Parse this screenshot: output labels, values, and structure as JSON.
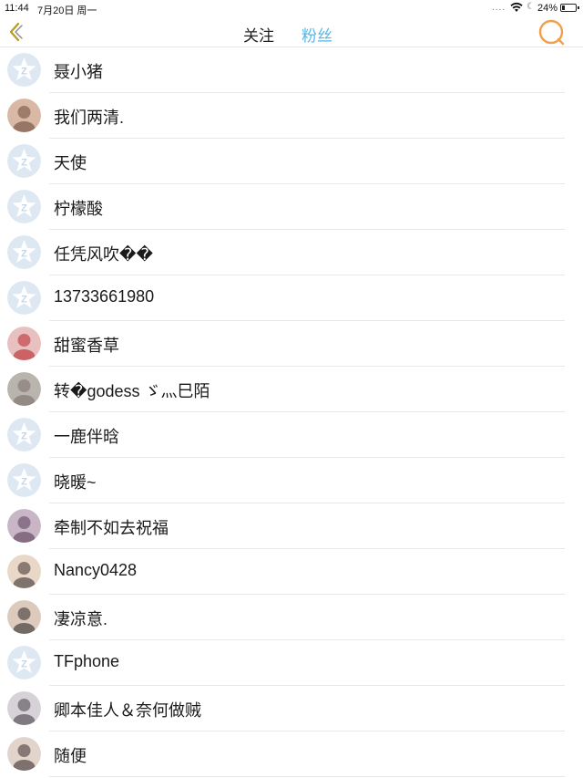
{
  "status_bar": {
    "time": "11:44",
    "date": "7月20日 周一",
    "signal_dots": "....",
    "battery": "24%",
    "battery_level": 0.24
  },
  "nav": {
    "back_icon": "chevron-left-icon",
    "tabs": [
      {
        "label": "关注",
        "active": false
      },
      {
        "label": "粉丝",
        "active": true
      }
    ],
    "search_icon": "search-icon",
    "accent_color": "#56b6e5",
    "icon_color": "#b89a1c",
    "search_color": "#f0a04b"
  },
  "fans": [
    {
      "name": "聂小猪",
      "avatar": "default"
    },
    {
      "name": "我们两清.",
      "avatar": "photo"
    },
    {
      "name": "天使",
      "avatar": "default"
    },
    {
      "name": "柠檬酸",
      "avatar": "default"
    },
    {
      "name": "任凭风吹��",
      "avatar": "default"
    },
    {
      "name": "13733661980",
      "avatar": "default"
    },
    {
      "name": "甜蜜香草",
      "avatar": "photo"
    },
    {
      "name": "转�godess ゞ灬巳陌",
      "avatar": "photo"
    },
    {
      "name": "一鹿伴晗",
      "avatar": "default"
    },
    {
      "name": "晓暖~",
      "avatar": "default"
    },
    {
      "name": "牵制不如去祝福",
      "avatar": "photo"
    },
    {
      "name": "Nancy0428",
      "avatar": "photo"
    },
    {
      "name": "凄凉意.",
      "avatar": "photo"
    },
    {
      "name": "TFphone",
      "avatar": "default"
    },
    {
      "name": "卿本佳人＆奈何做贼",
      "avatar": "photo"
    },
    {
      "name": "随便",
      "avatar": "photo"
    }
  ]
}
